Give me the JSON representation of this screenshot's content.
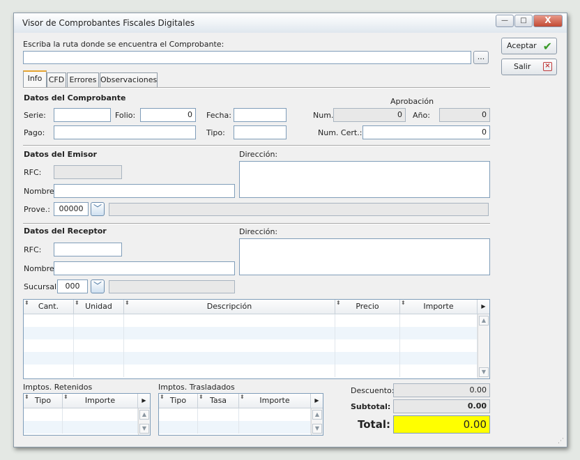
{
  "window": {
    "title": "Visor de Comprobantes Fiscales Digitales",
    "minimize": "—",
    "maximize": "□",
    "close": "X"
  },
  "path": {
    "label": "Escriba la ruta donde se encuentra el Comprobante:",
    "value": "",
    "browse": "..."
  },
  "actions": {
    "accept": "Aceptar",
    "exit": "Salir"
  },
  "tabs": [
    "Info",
    "CFD",
    "Errores",
    "Observaciones"
  ],
  "comprobante": {
    "heading": "Datos del Comprobante",
    "serie_label": "Serie:",
    "serie": "",
    "folio_label": "Folio:",
    "folio": "0",
    "fecha_label": "Fecha:",
    "fecha": "",
    "pago_label": "Pago:",
    "pago": "",
    "tipo_label": "Tipo:",
    "tipo": "",
    "aprobacion_label": "Aprobación",
    "num_label": "Num.:",
    "num": "0",
    "anio_label": "Año:",
    "anio": "0",
    "numcert_label": "Num. Cert.:",
    "numcert": "0"
  },
  "emisor": {
    "heading": "Datos del Emisor",
    "rfc_label": "RFC:",
    "rfc": "",
    "nombre_label": "Nombre:",
    "nombre": "",
    "direccion_label": "Dirección:",
    "prove_label": "Prove.:",
    "prove": "00000"
  },
  "receptor": {
    "heading": "Datos del Receptor",
    "rfc_label": "RFC:",
    "rfc": "",
    "nombre_label": "Nombre:",
    "nombre": "",
    "direccion_label": "Dirección:",
    "sucursal_label": "Sucursal:",
    "sucursal": "000"
  },
  "items_grid": {
    "columns": [
      "Cant.",
      "Unidad",
      "Descripción",
      "Precio",
      "Importe"
    ]
  },
  "retenidos": {
    "heading": "Imptos. Retenidos",
    "columns": [
      "Tipo",
      "Importe"
    ]
  },
  "trasladados": {
    "heading": "Imptos. Trasladados",
    "columns": [
      "Tipo",
      "Tasa",
      "Importe"
    ]
  },
  "totals": {
    "descuento_label": "Descuento:",
    "descuento": "0.00",
    "subtotal_label": "Subtotal:",
    "subtotal": "0.00",
    "total_label": "Total:",
    "total": "0.00",
    "total_color": "#ffff00"
  }
}
